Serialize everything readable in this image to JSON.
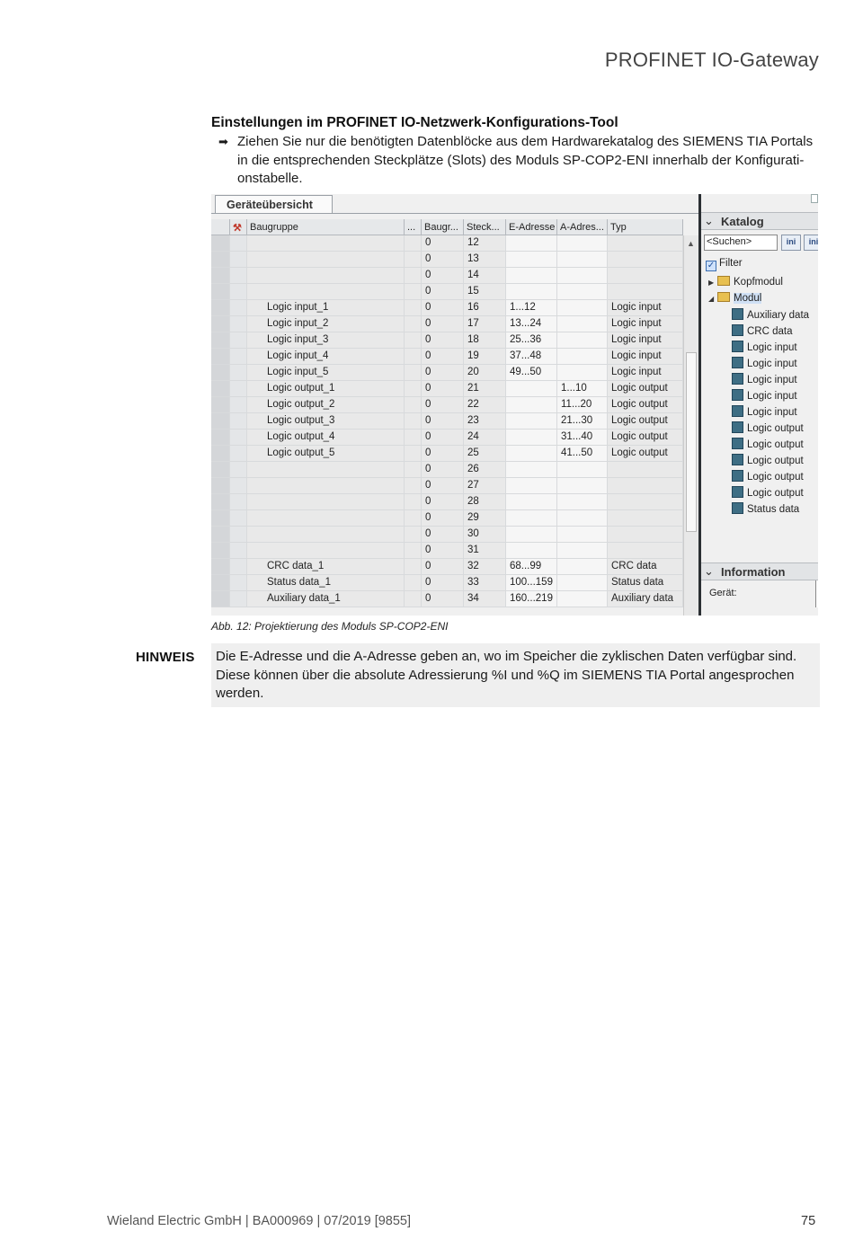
{
  "header": {
    "title": "PROFINET IO-Gateway"
  },
  "section": {
    "title": "Einstellungen im PROFINET IO-Netzwerk-Konfigurations-Tool",
    "bullet_symbol": "➡",
    "instruction": "Ziehen Sie nur die benötigten Datenblöcke aus dem Hardwarekatalog des SIEMENS TIA Portals in die entsprechenden Steckplätze (Slots) des Moduls SP-COP2-ENI innerhalb der Konfigurati-onstabelle."
  },
  "figure": {
    "tab_label": "Geräteübersicht",
    "columns": [
      "Baugruppe",
      "...",
      "Baugr...",
      "Steck...",
      "E-Adresse",
      "A-Adres...",
      "Typ"
    ],
    "rows": [
      [
        "",
        "0",
        "12",
        "",
        "",
        ""
      ],
      [
        "",
        "0",
        "13",
        "",
        "",
        ""
      ],
      [
        "",
        "0",
        "14",
        "",
        "",
        ""
      ],
      [
        "",
        "0",
        "15",
        "",
        "",
        ""
      ],
      [
        "Logic input_1",
        "0",
        "16",
        "1...12",
        "",
        "Logic input"
      ],
      [
        "Logic input_2",
        "0",
        "17",
        "13...24",
        "",
        "Logic input"
      ],
      [
        "Logic input_3",
        "0",
        "18",
        "25...36",
        "",
        "Logic input"
      ],
      [
        "Logic input_4",
        "0",
        "19",
        "37...48",
        "",
        "Logic input"
      ],
      [
        "Logic input_5",
        "0",
        "20",
        "49...50",
        "",
        "Logic input"
      ],
      [
        "Logic output_1",
        "0",
        "21",
        "",
        "1...10",
        "Logic output"
      ],
      [
        "Logic output_2",
        "0",
        "22",
        "",
        "11...20",
        "Logic output"
      ],
      [
        "Logic output_3",
        "0",
        "23",
        "",
        "21...30",
        "Logic output"
      ],
      [
        "Logic output_4",
        "0",
        "24",
        "",
        "31...40",
        "Logic output"
      ],
      [
        "Logic output_5",
        "0",
        "25",
        "",
        "41...50",
        "Logic output"
      ],
      [
        "",
        "0",
        "26",
        "",
        "",
        ""
      ],
      [
        "",
        "0",
        "27",
        "",
        "",
        ""
      ],
      [
        "",
        "0",
        "28",
        "",
        "",
        ""
      ],
      [
        "",
        "0",
        "29",
        "",
        "",
        ""
      ],
      [
        "",
        "0",
        "30",
        "",
        "",
        ""
      ],
      [
        "",
        "0",
        "31",
        "",
        "",
        ""
      ],
      [
        "CRC data_1",
        "0",
        "32",
        "68...99",
        "",
        "CRC data"
      ],
      [
        "Status data_1",
        "0",
        "33",
        "100...159",
        "",
        "Status data"
      ],
      [
        "Auxiliary data_1",
        "0",
        "34",
        "160...219",
        "",
        "Auxiliary data"
      ]
    ],
    "catalog": {
      "title": "Katalog",
      "search_placeholder": "<Suchen>",
      "filter_label": "Filter",
      "filter_checked": true,
      "btn1": "ini",
      "btn2": "ini",
      "folders": [
        "Kopfmodul",
        "Modul"
      ],
      "modules": [
        "Auxiliary data",
        "CRC data",
        "Logic input",
        "Logic input",
        "Logic input",
        "Logic input",
        "Logic input",
        "Logic output",
        "Logic output",
        "Logic output",
        "Logic output",
        "Logic output",
        "Status data"
      ]
    },
    "information": {
      "title": "Information",
      "device_label": "Gerät:"
    }
  },
  "caption": "Abb. 12: Projektierung des Moduls SP-COP2-ENI",
  "note": {
    "label": "HINWEIS",
    "text": "Die E-Adresse und die A-Adresse geben an, wo im Speicher die zyklischen Daten verfügbar sind. Diese können über die absolute Adressierung %I und %Q im SIEMENS TIA Portal angesprochen werden."
  },
  "footer": {
    "left": "Wieland Electric GmbH | BA000969 | 07/2019 [9855]",
    "page": "75"
  }
}
